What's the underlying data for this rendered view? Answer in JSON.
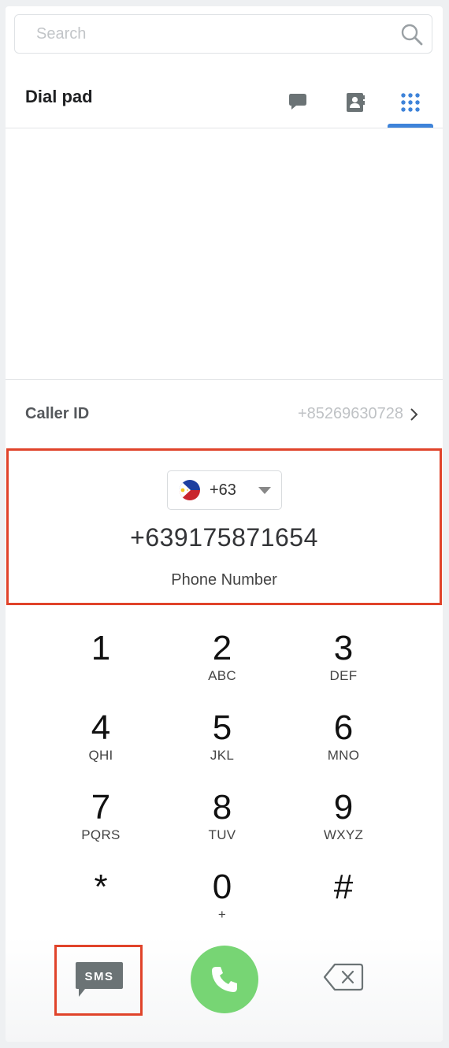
{
  "search": {
    "placeholder": "Search",
    "icon": "search-icon"
  },
  "header": {
    "title": "Dial pad",
    "tabs": [
      {
        "name": "messages",
        "icon": "chat-bubble-icon"
      },
      {
        "name": "contacts",
        "icon": "contact-book-icon"
      },
      {
        "name": "dialpad",
        "icon": "dialpad-grid-icon",
        "active": true
      }
    ]
  },
  "caller_id": {
    "label": "Caller ID",
    "value": "+85269630728",
    "icon": "chevron-right-icon"
  },
  "dialer": {
    "country_code": "+63",
    "country_flag": "philippines-flag-icon",
    "number": "+639175871654",
    "label": "Phone Number"
  },
  "keypad": {
    "keys": [
      {
        "digit": "1",
        "letters": ""
      },
      {
        "digit": "2",
        "letters": "ABC"
      },
      {
        "digit": "3",
        "letters": "DEF"
      },
      {
        "digit": "4",
        "letters": "QHI"
      },
      {
        "digit": "5",
        "letters": "JKL"
      },
      {
        "digit": "6",
        "letters": "MNO"
      },
      {
        "digit": "7",
        "letters": "PQRS"
      },
      {
        "digit": "8",
        "letters": "TUV"
      },
      {
        "digit": "9",
        "letters": "WXYZ"
      },
      {
        "digit": "*",
        "letters": ""
      },
      {
        "digit": "0",
        "letters": "+"
      },
      {
        "digit": "#",
        "letters": ""
      }
    ]
  },
  "actions": {
    "sms_label": "SMS",
    "call_icon": "phone-icon",
    "backspace_icon": "backspace-icon"
  },
  "colors": {
    "accent": "#3e83d9",
    "call": "#77d574",
    "highlight": "#e0432a",
    "icon_gray": "#6b7375"
  }
}
